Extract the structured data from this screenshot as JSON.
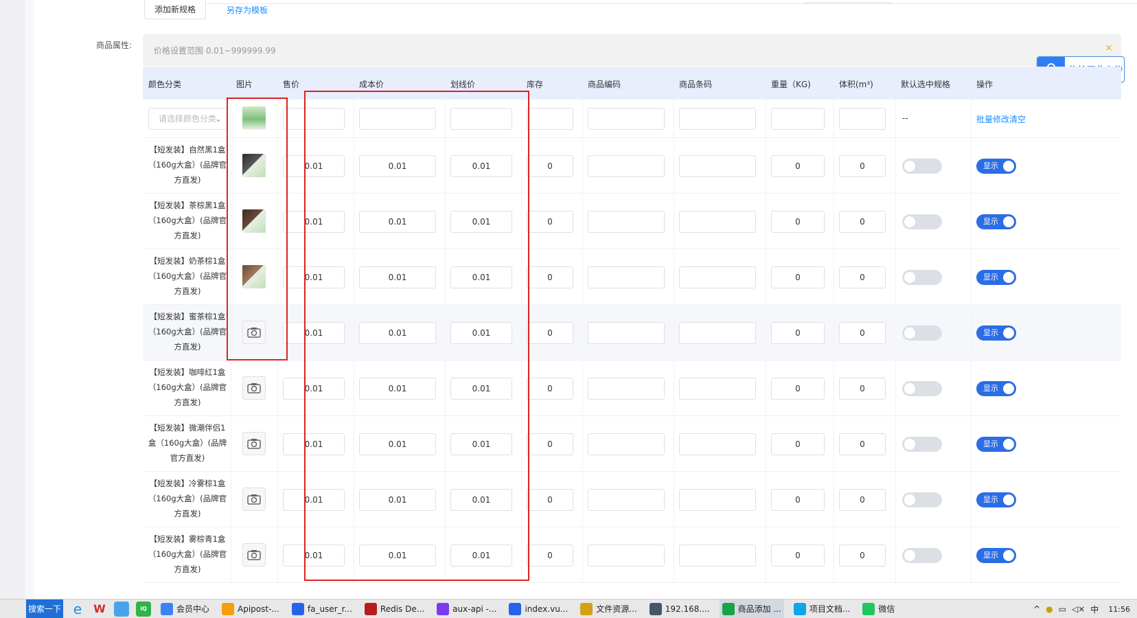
{
  "toolbar": {
    "add_spec_label": "添加新规格",
    "save_template_label": "另存为模板"
  },
  "attributes": {
    "label": "商品属性:",
    "range_hint": "价格设置范围 0.01~999999.99",
    "close": "×"
  },
  "upload": {
    "label": "拖拽至此上传"
  },
  "table": {
    "headers": [
      "颜色分类",
      "图片",
      "售价",
      "成本价",
      "划线价",
      "库存",
      "商品编码",
      "商品条码",
      "重量（KG)",
      "体积(m³)",
      "默认选中规格",
      "操作"
    ],
    "batch_row": {
      "select_placeholder": "请选择颜色分类",
      "default_dash": "--",
      "batch_action": "批量修改清空"
    },
    "rows": [
      {
        "name": "【短发装】自然黑1盒（160g大盒）(品牌官方直发)",
        "image": "photo",
        "price": "0.01",
        "cost": "0.01",
        "list_price": "0.01",
        "stock": "0",
        "weight": "0",
        "volume": "0",
        "status": "显示"
      },
      {
        "name": "【短发装】茶棕黑1盒（160g大盒）(品牌官方直发)",
        "image": "photo",
        "price": "0.01",
        "cost": "0.01",
        "list_price": "0.01",
        "stock": "0",
        "weight": "0",
        "volume": "0",
        "status": "显示"
      },
      {
        "name": "【短发装】奶茶棕1盒（160g大盒）(品牌官方直发)",
        "image": "photo",
        "price": "0.01",
        "cost": "0.01",
        "list_price": "0.01",
        "stock": "0",
        "weight": "0",
        "volume": "0",
        "status": "显示"
      },
      {
        "name": "【短发装】蜜茶棕1盒（160g大盒）(品牌官方直发)",
        "image": "camera",
        "price": "0.01",
        "cost": "0.01",
        "list_price": "0.01",
        "stock": "0",
        "weight": "0",
        "volume": "0",
        "status": "显示"
      },
      {
        "name": "【短发装】咖啡红1盒（160g大盒）(品牌官方直发)",
        "image": "camera",
        "price": "0.01",
        "cost": "0.01",
        "list_price": "0.01",
        "stock": "0",
        "weight": "0",
        "volume": "0",
        "status": "显示"
      },
      {
        "name": "【短发装】微潮伴侣1盒（160g大盒）(品牌官方直发)",
        "image": "camera",
        "price": "0.01",
        "cost": "0.01",
        "list_price": "0.01",
        "stock": "0",
        "weight": "0",
        "volume": "0",
        "status": "显示"
      },
      {
        "name": "【短发装】冷雾棕1盒（160g大盒）(品牌官方直发)",
        "image": "camera",
        "price": "0.01",
        "cost": "0.01",
        "list_price": "0.01",
        "stock": "0",
        "weight": "0",
        "volume": "0",
        "status": "显示"
      },
      {
        "name": "【短发装】雾棕青1盒（160g大盒）(品牌官方直发)",
        "image": "camera",
        "price": "0.01",
        "cost": "0.01",
        "list_price": "0.01",
        "stock": "0",
        "weight": "0",
        "volume": "0",
        "status": "显示"
      }
    ]
  },
  "taskbar": {
    "search_label": "搜索一下",
    "apps": [
      "会员中心",
      "Apipost-...",
      "fa_user_r...",
      "Redis De...",
      "aux-api -...",
      "index.vu...",
      "文件资源...",
      "192.168....",
      "商品添加 ...",
      "项目文档...",
      "微信"
    ],
    "tray_lang": "中",
    "time": "11:56"
  },
  "colors": {
    "accent": "#1890ff",
    "toggle_on": "#2b6de5",
    "header_bg": "#e9eefc",
    "annotation": "#e02020"
  }
}
